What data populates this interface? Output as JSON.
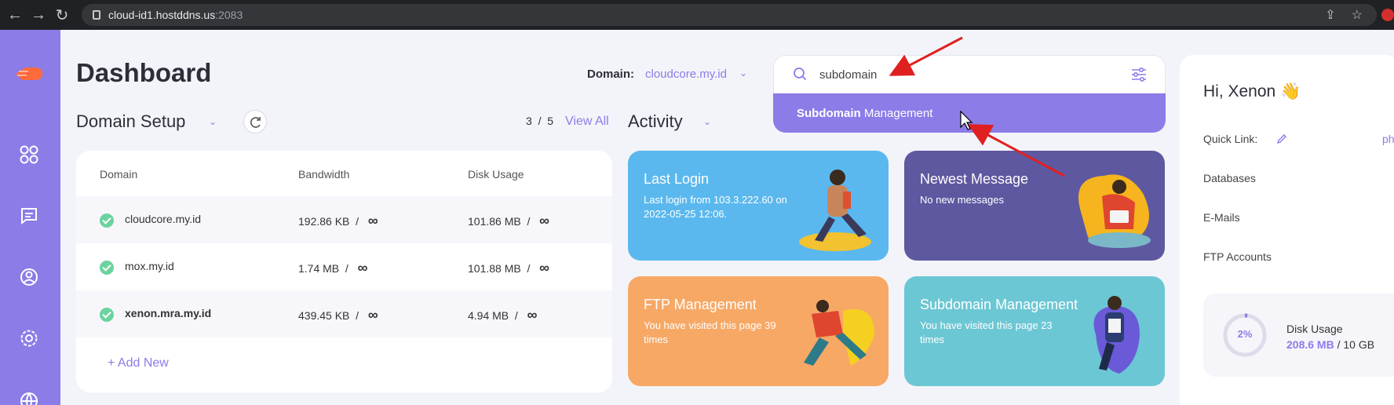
{
  "browser": {
    "url_host": "cloud-id1.hostddns.us",
    "url_port": ":2083"
  },
  "header": {
    "title": "Dashboard",
    "domain_label": "Domain:",
    "domain_value": "cloudcore.my.id"
  },
  "search": {
    "query": "subdomain",
    "result_match": "Subdomain",
    "result_rest": " Management"
  },
  "domain_setup": {
    "title": "Domain Setup",
    "pager_current": "3",
    "pager_sep": "/",
    "pager_total": "5",
    "view_all": "View All",
    "columns": [
      "Domain",
      "Bandwidth",
      "Disk Usage"
    ],
    "rows": [
      {
        "domain": "cloudcore.my.id",
        "bandwidth": "192.86 KB",
        "disk": "101.86 MB"
      },
      {
        "domain": "mox.my.id",
        "bandwidth": "1.74 MB",
        "disk": "101.88 MB"
      },
      {
        "domain": "xenon.mra.my.id",
        "bandwidth": "439.45 KB",
        "disk": "4.94 MB"
      }
    ],
    "unlimited_symbol": "∞",
    "separator": "/",
    "add_new": "+ Add New"
  },
  "activity": {
    "title": "Activity",
    "cards": [
      {
        "title": "Last Login",
        "body": "Last login from 103.3.222.60 on 2022-05-25 12:06.",
        "color": "#5ab8ee"
      },
      {
        "title": "Newest Message",
        "body": "No new messages",
        "color": "#5e58a0"
      },
      {
        "title": "FTP Management",
        "body": "You have visited this page 39 times",
        "color": "#f7a865"
      },
      {
        "title": "Subdomain Management",
        "body": "You have visited this page 23 times",
        "color": "#6cc7d4"
      }
    ]
  },
  "right_panel": {
    "greeting": "Hi, Xenon 👋",
    "quick_link_label": "Quick Link:",
    "quick_link_value": "ph",
    "items": [
      "Databases",
      "E-Mails",
      "FTP Accounts"
    ],
    "disk": {
      "percent_label": "2%",
      "percent": 2,
      "label": "Disk Usage",
      "used": "208.6 MB",
      "sep": " / ",
      "total": "10 GB"
    }
  },
  "colors": {
    "accent": "#8b7ce8",
    "annotation_arrow": "#e02020"
  },
  "icons": [
    "back-arrow-icon",
    "forward-arrow-icon",
    "reload-icon",
    "lock-icon",
    "share-icon",
    "star-icon",
    "logo-icon",
    "apps-grid-icon",
    "chat-icon",
    "user-icon",
    "settings-icon",
    "globe-icon",
    "search-icon",
    "filter-icon",
    "refresh-icon",
    "chevron-down-icon",
    "check-icon",
    "edit-icon",
    "mouse-cursor-icon"
  ]
}
